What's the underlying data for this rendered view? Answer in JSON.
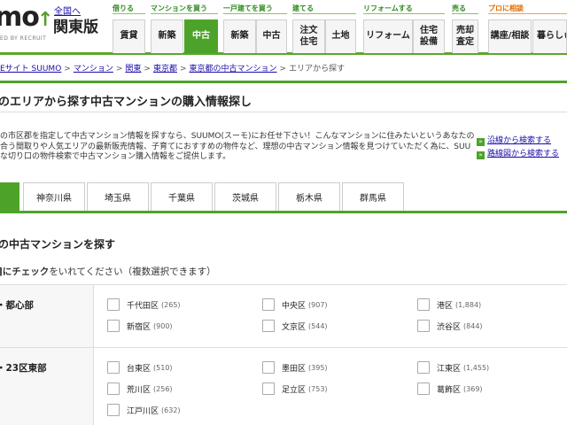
{
  "header": {
    "logo_text": "mo",
    "logo_sub": "ED BY RECRUIT",
    "national_link": "全国へ",
    "region": "関東版",
    "groups": {
      "rent": "借りる",
      "buy_mansion": "マンションを買う",
      "buy_house": "一戸建てを買う",
      "build": "建てる",
      "reform": "リフォームする",
      "sell": "売る",
      "pro": "プロに相談"
    },
    "nav": {
      "chintai": "賃貸",
      "mansion_new": "新築",
      "mansion_used": "中古",
      "house_new": "新築",
      "house_used": "中古",
      "custom_house_1": "注文",
      "custom_house_2": "住宅",
      "land": "土地",
      "reform": "リフォーム",
      "housing_equip_1": "住宅",
      "housing_equip_2": "設備",
      "sell_assess_1": "売却",
      "sell_assess_2": "査定",
      "seminar": "講座/相談",
      "living": "暮らしぃ"
    }
  },
  "breadcrumb": {
    "items": [
      "Eサイト SUUMO",
      "マンション",
      "関東",
      "東京都",
      "東京都の中古マンション"
    ],
    "current": "エリアから探す",
    "separator": ">"
  },
  "page_title": "のエリアから探す中古マンションの購入情報探し",
  "intro": {
    "lines": [
      "の市区郡を指定して中古マンション情報を探すなら、SUUMO(スーモ)にお任せ下さい！こんなマンションに住みたいというあなたの",
      "合う間取りや人気エリアの最新販売情報、子育てにおすすめの物件など、理想の中古マンション情報を見つけていただく為に、SUU",
      "な切り口の物件検索で中古マンション購入情報をご提供します。"
    ],
    "link_line": "沿線から検索する",
    "link_map": "路線図から検索する"
  },
  "pref_tabs": [
    "神奈川県",
    "埼玉県",
    "千葉県",
    "茨城県",
    "栃木県",
    "群馬県"
  ],
  "section": {
    "title": "の中古マンションを探す",
    "check_note_bold": "]にチェック",
    "check_note_rest": "をいれてください（複数選択できます）"
  },
  "areas": [
    {
      "name": "・都心部",
      "wards": [
        {
          "name": "千代田区",
          "count": "(265)"
        },
        {
          "name": "中央区",
          "count": "(907)"
        },
        {
          "name": "港区",
          "count": "(1,884)"
        },
        {
          "name": "新宿区",
          "count": "(900)"
        },
        {
          "name": "文京区",
          "count": "(544)"
        },
        {
          "name": "渋谷区",
          "count": "(844)"
        }
      ]
    },
    {
      "name": "・23区東部",
      "wards": [
        {
          "name": "台東区",
          "count": "(510)"
        },
        {
          "name": "墨田区",
          "count": "(395)"
        },
        {
          "name": "江東区",
          "count": "(1,455)"
        },
        {
          "name": "荒川区",
          "count": "(256)"
        },
        {
          "name": "足立区",
          "count": "(753)"
        },
        {
          "name": "葛飾区",
          "count": "(369)"
        },
        {
          "name": "江戸川区",
          "count": "(632)"
        }
      ]
    }
  ],
  "colors": {
    "accent": "#4da32a",
    "link": "#1a0dab"
  }
}
